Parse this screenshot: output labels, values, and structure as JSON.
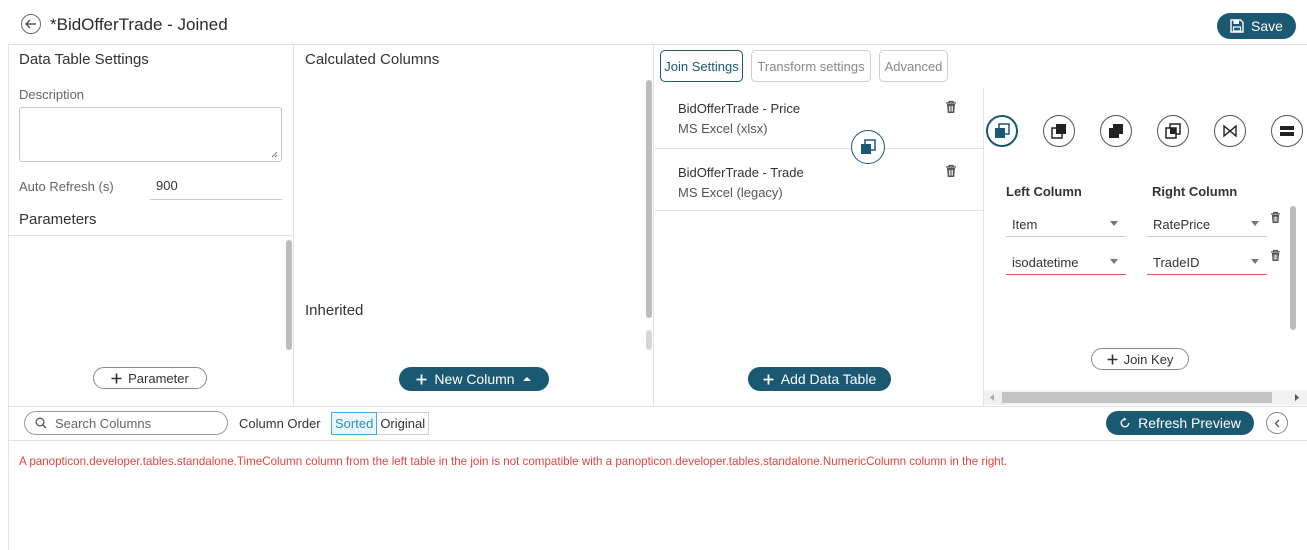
{
  "header": {
    "title": "*BidOfferTrade - Joined",
    "save_label": "Save"
  },
  "data_table_settings": {
    "title": "Data Table Settings",
    "description_label": "Description",
    "description_value": "",
    "auto_refresh_label": "Auto Refresh (s)",
    "auto_refresh_value": "900",
    "parameters_title": "Parameters",
    "add_parameter_label": "Parameter"
  },
  "calculated_columns": {
    "title": "Calculated Columns",
    "inherited_label": "Inherited",
    "new_column_label": "New Column"
  },
  "join": {
    "tabs": [
      {
        "label": "Join Settings",
        "active": true
      },
      {
        "label": "Transform settings",
        "active": false
      },
      {
        "label": "Advanced",
        "active": false
      }
    ],
    "tables": [
      {
        "name": "BidOfferTrade - Price",
        "source": "MS Excel (xlsx)"
      },
      {
        "name": "BidOfferTrade - Trade",
        "source": "MS Excel (legacy)"
      }
    ],
    "add_table_label": "Add Data Table",
    "join_types": [
      "left-join-icon",
      "right-join-icon",
      "inner-join-icon",
      "outer-join-icon",
      "natural-join-icon",
      "union-icon"
    ],
    "left_column_header": "Left Column",
    "right_column_header": "Right Column",
    "keys": [
      {
        "left": "Item",
        "right": "RatePrice",
        "error": false
      },
      {
        "left": "isodatetime",
        "right": "TradeID",
        "error": true
      }
    ],
    "join_key_label": "Join Key"
  },
  "preview": {
    "search_placeholder": "Search Columns",
    "column_order_label": "Column Order",
    "order_sorted": "Sorted",
    "order_original": "Original",
    "refresh_label": "Refresh Preview",
    "error_message": "A panopticon.developer.tables.standalone.TimeColumn column from the left table in the join is not compatible with a panopticon.developer.tables.standalone.NumericColumn column in the right."
  },
  "colors": {
    "accent": "#1b5872",
    "error": "#e04545",
    "sorted": "#2a8fc4"
  }
}
